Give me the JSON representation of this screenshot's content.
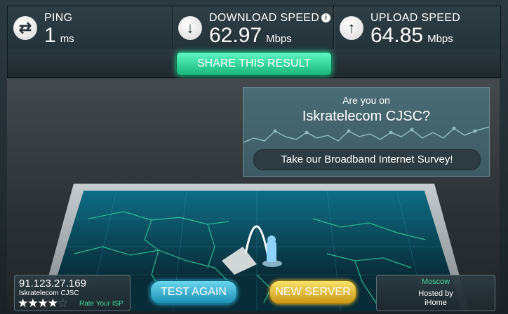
{
  "stats": {
    "ping": {
      "label": "PING",
      "value": "1",
      "unit": "ms",
      "icon": "swap-arrows-icon"
    },
    "download": {
      "label": "DOWNLOAD SPEED",
      "value": "62.97",
      "unit": "Mbps",
      "icon": "down-arrow-icon",
      "info": "i"
    },
    "upload": {
      "label": "UPLOAD SPEED",
      "value": "64.85",
      "unit": "Mbps",
      "icon": "up-arrow-icon"
    }
  },
  "share_label": "SHARE THIS RESULT",
  "survey": {
    "question_line1": "Are you on",
    "question_line2": "Iskratelecom CJSC?",
    "cta": "Take our Broadband Internet Survey!"
  },
  "isp": {
    "ip": "91.123.27.169",
    "name": "Iskratelecom CJSC",
    "rating_stars": 4,
    "rating_max": 5,
    "rate_label": "Rate Your ISP"
  },
  "buttons": {
    "test_again": "TEST AGAIN",
    "new_server": "NEW SERVER"
  },
  "server": {
    "city": "Moscow",
    "hosted_by_label": "Hosted by",
    "host": "iHome"
  },
  "colors": {
    "accent_green": "#1fc98a",
    "accent_blue": "#2aa7cf",
    "accent_yellow": "#e8c23a"
  }
}
